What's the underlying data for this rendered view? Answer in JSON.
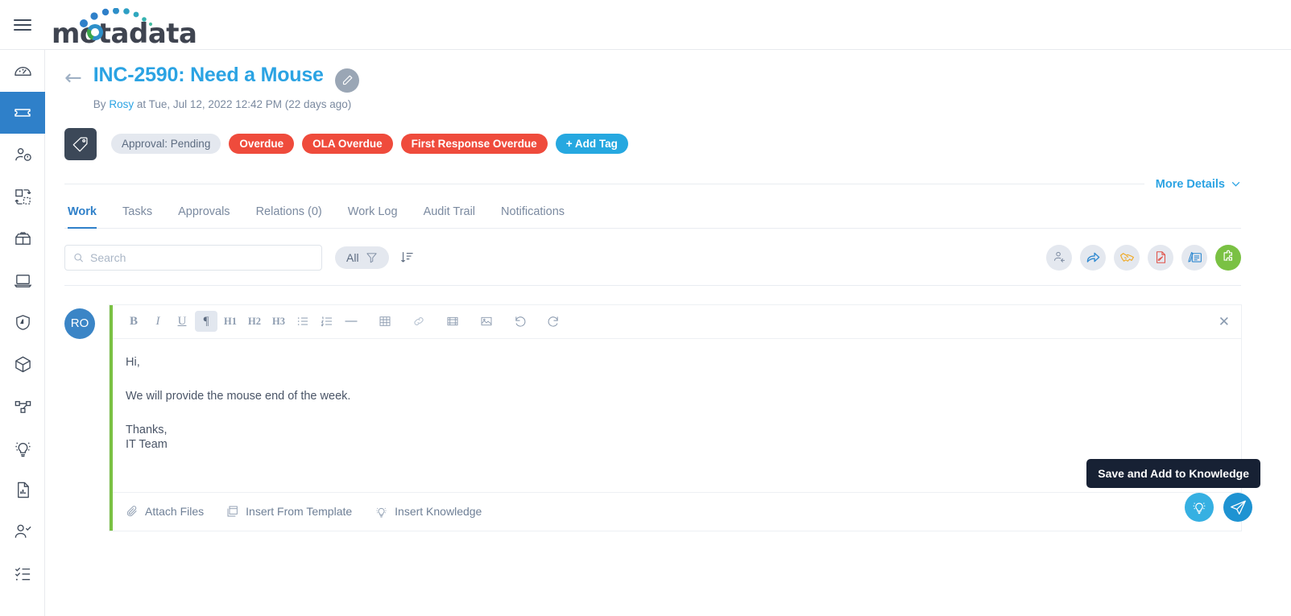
{
  "app": {
    "brand": "motadata",
    "menu_icon": "hamburger-icon"
  },
  "sidebar": {
    "items": [
      {
        "icon": "dashboard-gauge-icon",
        "name": "dashboard",
        "active": false
      },
      {
        "icon": "ticket-icon",
        "name": "tickets",
        "active": true
      },
      {
        "icon": "user-alert-icon",
        "name": "problems",
        "active": false
      },
      {
        "icon": "change-icon",
        "name": "changes",
        "active": false
      },
      {
        "icon": "release-box-icon",
        "name": "releases",
        "active": false
      },
      {
        "icon": "laptop-icon",
        "name": "assets",
        "active": false
      },
      {
        "icon": "shield-icon",
        "name": "security",
        "active": false
      },
      {
        "icon": "cube-icon",
        "name": "cmdb",
        "active": false
      },
      {
        "icon": "node-graph-icon",
        "name": "relations",
        "active": false
      },
      {
        "icon": "lightbulb-icon",
        "name": "knowledge",
        "active": false
      },
      {
        "icon": "report-document-icon",
        "name": "reports",
        "active": false
      },
      {
        "icon": "user-check-icon",
        "name": "approvals",
        "active": false
      },
      {
        "icon": "checklist-icon",
        "name": "tasks",
        "active": false
      }
    ]
  },
  "ticket": {
    "back_icon": "back-arrow-icon",
    "title": "INC-2590: Need a Mouse",
    "edit_icon": "pencil-icon",
    "byline_prefix": "By",
    "author": "Rosy",
    "byline_suffix": "at Tue, Jul 12, 2022 12:42 PM (22 days ago)"
  },
  "tags": {
    "tag_icon": "tag-icon",
    "items": [
      {
        "label": "Approval: Pending",
        "style": "neutral"
      },
      {
        "label": "Overdue",
        "style": "danger"
      },
      {
        "label": "OLA Overdue",
        "style": "danger"
      },
      {
        "label": "First Response Overdue",
        "style": "danger"
      }
    ],
    "add_tag_label": "+ Add Tag"
  },
  "more_details": {
    "label": "More Details",
    "chevron_icon": "chevron-down-icon"
  },
  "tabs": [
    {
      "label": "Work",
      "active": true
    },
    {
      "label": "Tasks",
      "active": false
    },
    {
      "label": "Approvals",
      "active": false
    },
    {
      "label": "Relations (0)",
      "active": false
    },
    {
      "label": "Work Log",
      "active": false
    },
    {
      "label": "Audit Trail",
      "active": false
    },
    {
      "label": "Notifications",
      "active": false
    }
  ],
  "filter_bar": {
    "search_placeholder": "Search",
    "search_value": "",
    "search_icon": "search-icon",
    "filter_label": "All",
    "filter_icon": "funnel-icon",
    "sort_icon": "sort-descending-icon",
    "actions": [
      {
        "name": "reply-to-requester",
        "icon": "person-reply-icon",
        "color": "#7b8aa0"
      },
      {
        "name": "forward",
        "icon": "forward-arrow-icon",
        "color": "#2f89d0"
      },
      {
        "name": "collaborate",
        "icon": "handshake-icon",
        "color": "#f0a821"
      },
      {
        "name": "add-note",
        "icon": "document-edit-icon",
        "color": "#e0534a"
      },
      {
        "name": "add-work-note",
        "icon": "note-pencil-icon",
        "color": "#2f89d0"
      },
      {
        "name": "add-solution",
        "icon": "puzzle-icon",
        "color": "#ffffff"
      }
    ]
  },
  "editor": {
    "avatar_initials": "RO",
    "close_icon": "close-icon",
    "toolbar": [
      {
        "label": "B",
        "name": "bold-button",
        "style": "bold",
        "active": false
      },
      {
        "label": "I",
        "name": "italic-button",
        "style": "italic",
        "active": false
      },
      {
        "label": "U",
        "name": "underline-button",
        "style": "underline",
        "active": false
      },
      {
        "label": "¶",
        "name": "paragraph-button",
        "style": "plain",
        "active": true
      },
      {
        "label": "H1",
        "name": "heading-1-button",
        "style": "small",
        "active": false
      },
      {
        "label": "H2",
        "name": "heading-2-button",
        "style": "small",
        "active": false
      },
      {
        "label": "H3",
        "name": "heading-3-button",
        "style": "small",
        "active": false
      }
    ],
    "toolbar_icons": [
      {
        "name": "bullet-list-icon"
      },
      {
        "name": "numbered-list-icon"
      },
      {
        "name": "horizontal-rule-icon"
      },
      {
        "name": "table-icon"
      },
      {
        "name": "link-icon"
      },
      {
        "name": "video-icon"
      },
      {
        "name": "image-icon"
      },
      {
        "name": "undo-icon"
      },
      {
        "name": "redo-icon"
      }
    ],
    "body": {
      "line1": "Hi,",
      "line2": "We will provide the mouse end of the week.",
      "line3": "Thanks,",
      "line4": "IT Team"
    },
    "footer_actions": [
      {
        "label": "Attach Files",
        "icon": "paperclip-icon",
        "name": "attach-files"
      },
      {
        "label": "Insert From Template",
        "icon": "template-icon",
        "name": "insert-from-template"
      },
      {
        "label": "Insert Knowledge",
        "icon": "lightbulb-icon",
        "name": "insert-knowledge"
      }
    ]
  },
  "floating": {
    "tooltip": "Save and Add to Knowledge",
    "bulb_button": {
      "name": "save-and-add-to-knowledge-button",
      "icon": "lightbulb-icon",
      "color": "#36b0e2"
    },
    "send_button": {
      "name": "send-button",
      "icon": "paper-plane-icon",
      "color": "#1e93d2"
    },
    "badge_button": {
      "name": "save-reply-button",
      "icon": "arrow-up-right-icon",
      "color": "#27b473"
    }
  },
  "colors": {
    "brand_blue": "#2ba3e3",
    "active_blue": "#2f80c9",
    "danger_red": "#ef4b3c",
    "green": "#7ac143",
    "dark": "#172134"
  }
}
